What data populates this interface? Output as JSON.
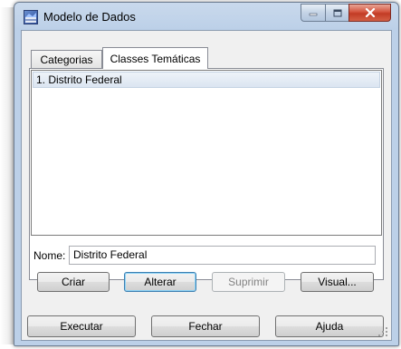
{
  "window": {
    "title": "Modelo de Dados",
    "icon": "database-model-icon",
    "controls": {
      "minimize": "minimize-icon",
      "maximize": "maximize-icon",
      "close": "close-icon"
    }
  },
  "tabs": [
    {
      "label": "Categorias",
      "selected": false
    },
    {
      "label": "Classes Temáticas",
      "selected": true
    }
  ],
  "list": {
    "items": [
      {
        "label": "1. Distrito Federal",
        "selected": true
      }
    ]
  },
  "name_field": {
    "label": "Nome:",
    "value": "Distrito Federal"
  },
  "actions": {
    "criar": "Criar",
    "alterar": "Alterar",
    "suprimir": "Suprimir",
    "visual": "Visual..."
  },
  "footer": {
    "executar": "Executar",
    "fechar": "Fechar",
    "ajuda": "Ajuda"
  },
  "colors": {
    "frame": "#bcd0e8",
    "client": "#f0f0f0",
    "close_button": "#c23b25",
    "selection": "#dbe5f1"
  }
}
